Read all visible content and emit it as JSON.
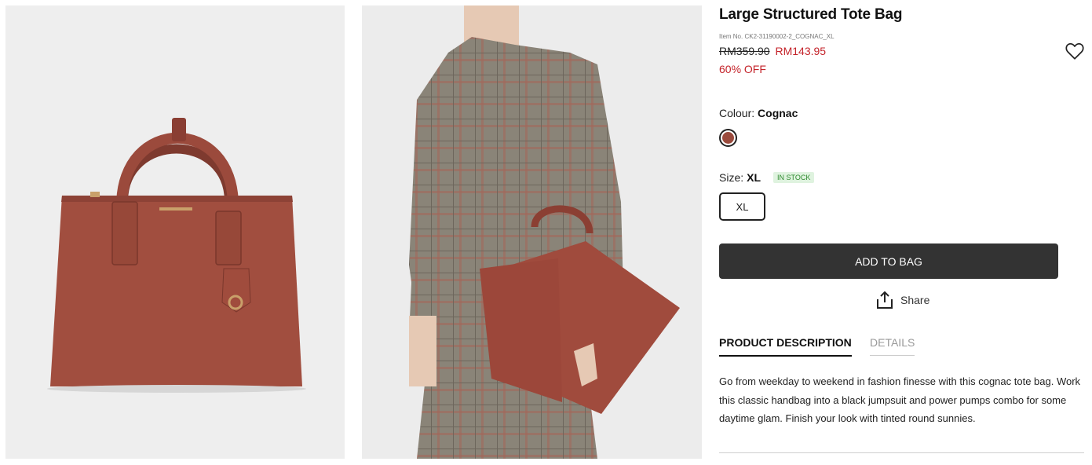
{
  "product": {
    "title": "Large Structured Tote Bag",
    "item_no": "Item No. CK2-31190002-2_COGNAC_XL",
    "old_price": "RM359.90",
    "new_price": "RM143.95",
    "discount": "60% OFF"
  },
  "colour": {
    "label": "Colour:",
    "value": "Cognac",
    "swatch_color": "#9a4a3c"
  },
  "size": {
    "label": "Size:",
    "value": "XL",
    "stock": "IN STOCK",
    "option": "XL"
  },
  "actions": {
    "add_to_bag": "ADD TO BAG",
    "share": "Share"
  },
  "tabs": {
    "description": "PRODUCT DESCRIPTION",
    "details": "DETAILS"
  },
  "description": "Go from weekday to weekend in fashion finesse with this cognac tote bag. Work this classic handbag into a black jumpsuit and power pumps combo for some daytime glam. Finish your look with tinted round sunnies.",
  "icons": [
    "heart-icon",
    "share-icon"
  ],
  "colors": {
    "accent_red": "#c4232a",
    "button_dark": "#333333",
    "stock_green": "#2f8a2f"
  }
}
